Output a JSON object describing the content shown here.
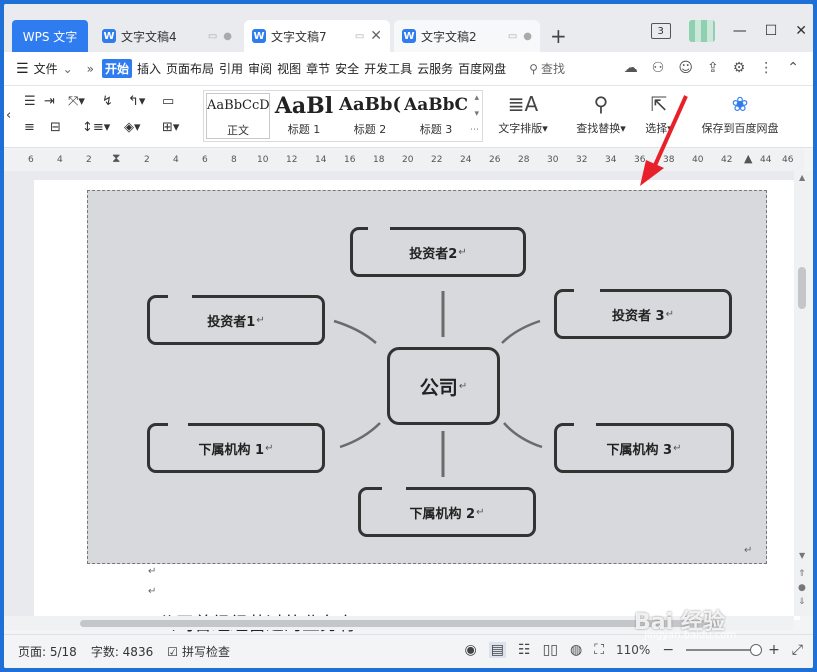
{
  "tabs": {
    "app": "WPS 文字",
    "doc4": "文字文稿4",
    "doc7": "文字文稿7",
    "doc2": "文字文稿2",
    "badge": "3"
  },
  "menu": {
    "file": "文件",
    "items": [
      "开始",
      "插入",
      "页面布局",
      "引用",
      "审阅",
      "视图",
      "章节",
      "安全",
      "开发工具",
      "云服务",
      "百度网盘"
    ],
    "search": "查找"
  },
  "ribbon": {
    "styles": [
      {
        "sample": "AaBbCcDd",
        "name": "正文"
      },
      {
        "sample": "AaBl",
        "name": "标题 1"
      },
      {
        "sample": "AaBb(",
        "name": "标题 2"
      },
      {
        "sample": "AaBbC",
        "name": "标题 3"
      }
    ],
    "text_layout": "文字排版",
    "find_replace": "查找替换",
    "select": "选择",
    "save_baidu": "保存到百度网盘"
  },
  "ruler_ticks": [
    "6",
    "4",
    "2",
    "2",
    "4",
    "6",
    "8",
    "10",
    "12",
    "14",
    "16",
    "18",
    "20",
    "22",
    "24",
    "26",
    "28",
    "30",
    "32",
    "34",
    "36",
    "38",
    "40",
    "42",
    "44",
    "46"
  ],
  "diagram": {
    "center": "公司",
    "investor1": "投资者1",
    "investor2": "投资者2",
    "investor3": "投资者 3",
    "sub1": "下属机构 1",
    "sub2": "下属机构 2",
    "sub3": "下属机构 3",
    "para_mark": "↵"
  },
  "body_text": "公司曾经经营过的业务有",
  "status": {
    "page": "页面: 5/18",
    "words": "字数: 4836",
    "spell": "拼写检查",
    "zoom": "110%"
  },
  "watermark": {
    "brand": "Bai 经验",
    "url": "jingyan.baidu.com"
  },
  "colors": {
    "accent": "#2f7bf0",
    "annotation_arrow": "#e8202a"
  }
}
